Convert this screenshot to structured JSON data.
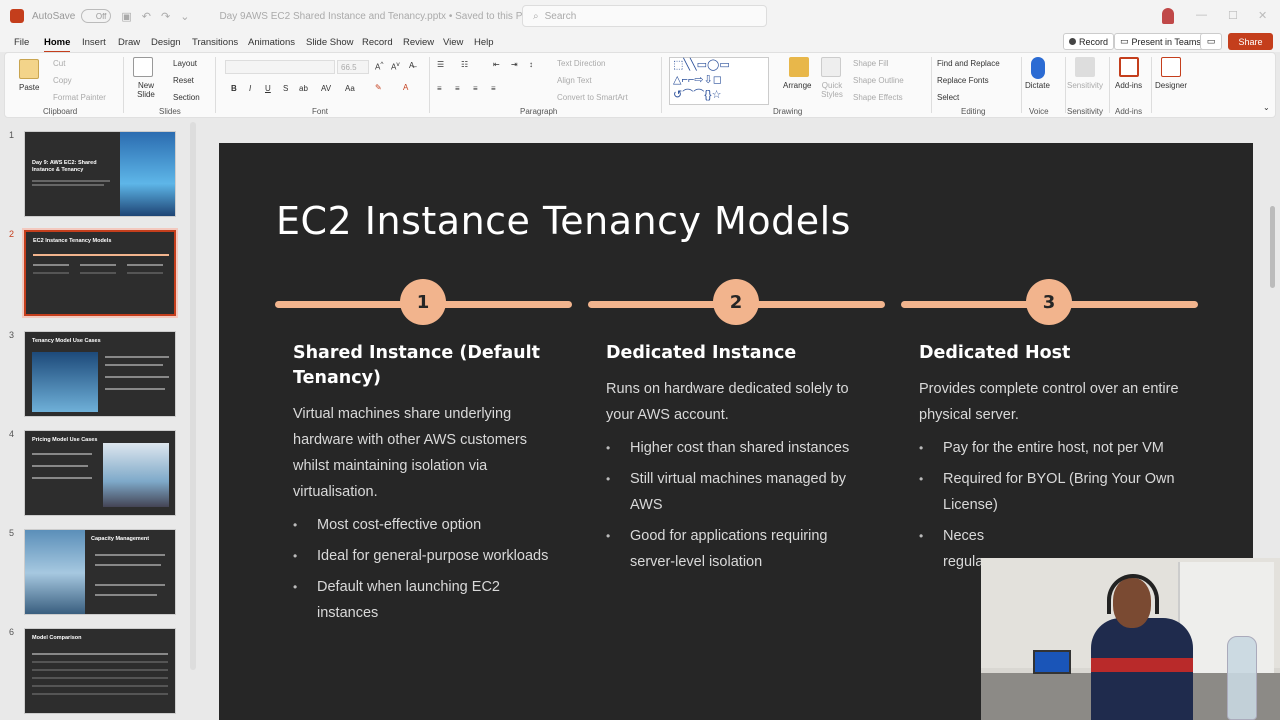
{
  "titlebar": {
    "autosave_label": "AutoSave",
    "autosave_state": "Off",
    "doc_title": "Day 9AWS EC2 Shared Instance and Tenancy.pptx • Saved to this PC ⌄",
    "search_placeholder": "Search"
  },
  "menu": {
    "tabs": [
      "File",
      "Home",
      "Insert",
      "Draw",
      "Design",
      "Transitions",
      "Animations",
      "Slide Show",
      "Record",
      "Review",
      "View",
      "Help"
    ],
    "active_tab": "Home",
    "record_label": "Record",
    "present_label": "Present in Teams",
    "share_label": "Share"
  },
  "ribbon": {
    "clipboard": {
      "paste": "Paste",
      "cut": "Cut",
      "copy": "Copy",
      "format_painter": "Format Painter",
      "label": "Clipboard"
    },
    "slides": {
      "new_slide": "New Slide",
      "layout": "Layout",
      "reset": "Reset",
      "section": "Section",
      "label": "Slides"
    },
    "font": {
      "label": "Font",
      "size": "66.5"
    },
    "paragraph": {
      "text_direction": "Text Direction",
      "align_text": "Align Text",
      "smartart": "Convert to SmartArt",
      "label": "Paragraph"
    },
    "drawing": {
      "arrange": "Arrange",
      "quick_styles": "Quick Styles",
      "shape_fill": "Shape Fill",
      "shape_outline": "Shape Outline",
      "shape_effects": "Shape Effects",
      "label": "Drawing"
    },
    "editing": {
      "find_replace": "Find and Replace",
      "replace_fonts": "Replace Fonts",
      "select": "Select",
      "label": "Editing"
    },
    "voice": {
      "dictate": "Dictate",
      "label": "Voice"
    },
    "sensitivity": {
      "sensitivity": "Sensitivity",
      "label": "Sensitivity"
    },
    "addins": {
      "addins": "Add-ins",
      "label": "Add-ins"
    },
    "designer": {
      "designer": "Designer"
    }
  },
  "thumbnails": [
    {
      "num": "1",
      "title": "Day 9: AWS EC2: Shared Instance & Tenancy"
    },
    {
      "num": "2",
      "title": "EC2 Instance Tenancy Models"
    },
    {
      "num": "3",
      "title": "Tenancy Model Use Cases"
    },
    {
      "num": "4",
      "title": "Pricing Model Use Cases"
    },
    {
      "num": "5",
      "title": "Capacity Management"
    },
    {
      "num": "6",
      "title": "Model Comparison"
    }
  ],
  "slide": {
    "title": "EC2 Instance Tenancy Models",
    "columns": [
      {
        "num": "1",
        "heading": "Shared Instance (Default Tenancy)",
        "desc": "Virtual machines share underlying hardware with other AWS customers whilst maintaining isolation via virtualisation.",
        "bullets": [
          "Most cost-effective option",
          "Ideal for general-purpose workloads",
          "Default when launching EC2 instances"
        ]
      },
      {
        "num": "2",
        "heading": "Dedicated Instance",
        "desc": "Runs on hardware dedicated solely to your AWS account.",
        "bullets": [
          "Higher cost than shared instances",
          "Still virtual machines managed by AWS",
          "Good for applications requiring server-level isolation"
        ]
      },
      {
        "num": "3",
        "heading": "Dedicated Host",
        "desc": "Provides complete control over an entire physical server.",
        "bullets": [
          "Pay for the entire host, not per VM",
          "Required for BYOL (Bring Your Own License)",
          "Neces regula"
        ]
      }
    ]
  },
  "colors": {
    "accent": "#c43e1c",
    "timeline": "#f2b48d",
    "slide_bg": "#262626"
  }
}
